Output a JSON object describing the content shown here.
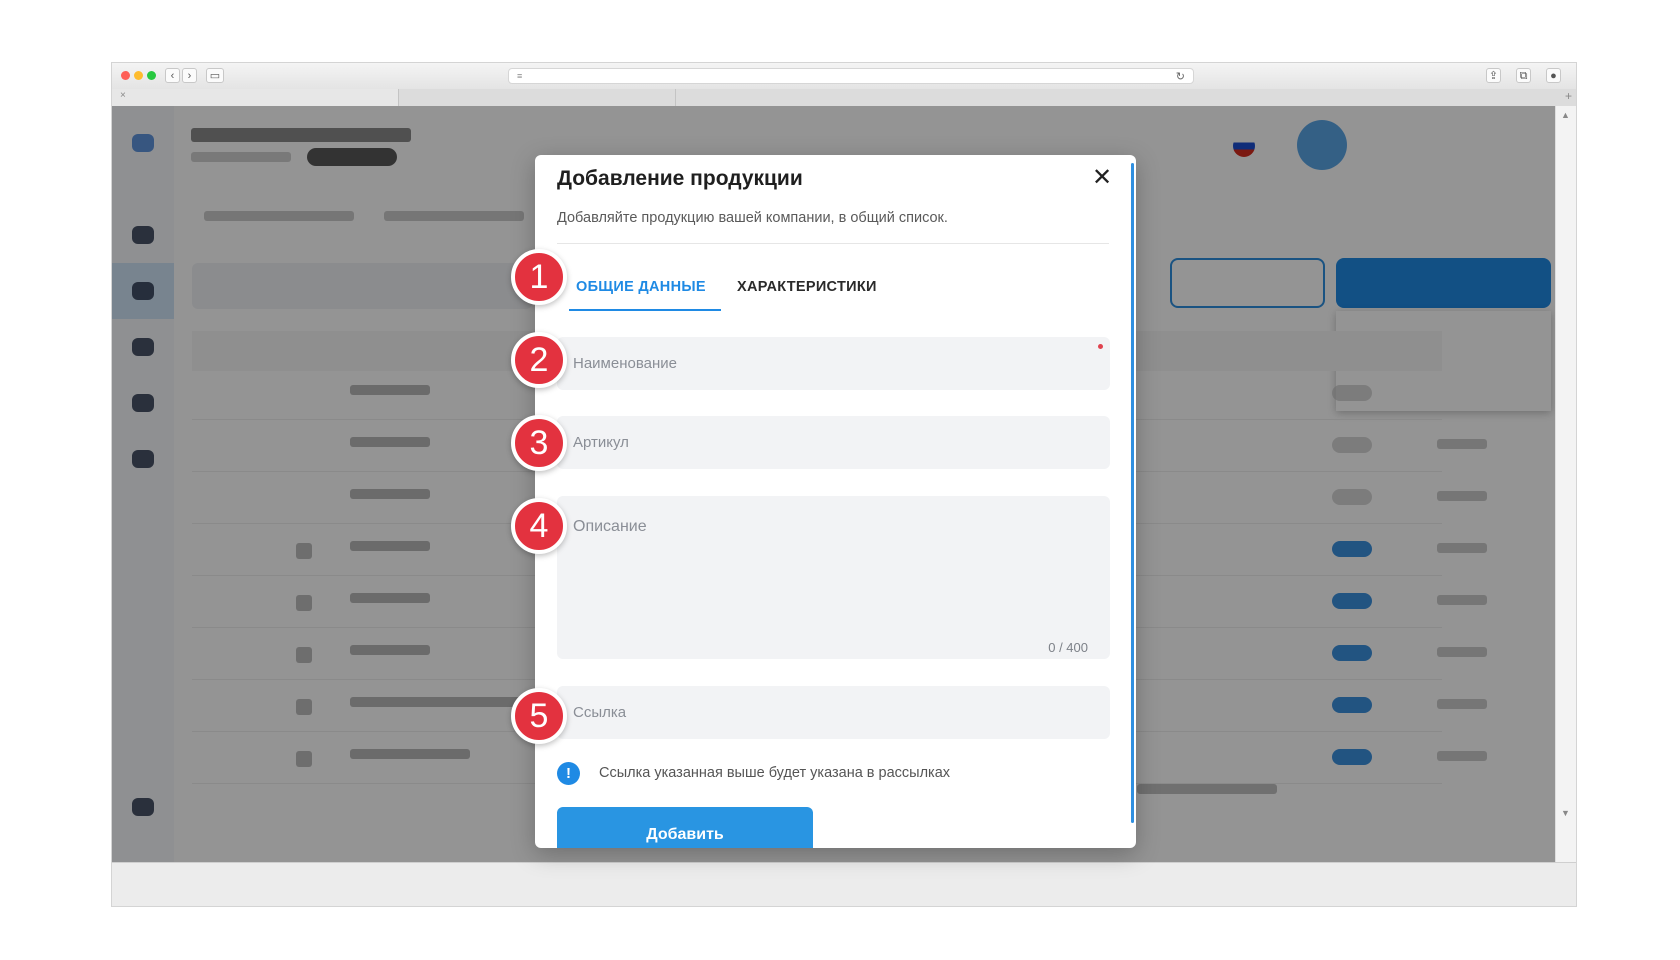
{
  "modal": {
    "title": "Добавление продукции",
    "subtitle": "Добавляйте продукцию вашей компании, в общий список.",
    "close_icon": "close-icon",
    "tabs": [
      {
        "label": "ОБЩИЕ ДАННЫЕ",
        "active": true
      },
      {
        "label": "ХАРАКТЕРИСТИКИ",
        "active": false
      }
    ],
    "fields": {
      "name": {
        "value": "",
        "placeholder": "Наименование",
        "required": true
      },
      "article": {
        "value": "",
        "placeholder": "Артикул"
      },
      "description": {
        "value": "",
        "placeholder": "Описание",
        "counter": "0 / 400"
      },
      "link": {
        "value": "",
        "placeholder": "Ссылка"
      }
    },
    "info": {
      "icon": "info-icon",
      "symbol": "!",
      "text": "Ссылка указанная выше будет указана в рассылках"
    },
    "submit_label": "Добавить"
  },
  "markers": [
    "1",
    "2",
    "3",
    "4",
    "5"
  ],
  "colors": {
    "accent": "#1f8ae4",
    "button": "#2995e2",
    "marker": "#e3323f",
    "required": "#e0434f"
  }
}
